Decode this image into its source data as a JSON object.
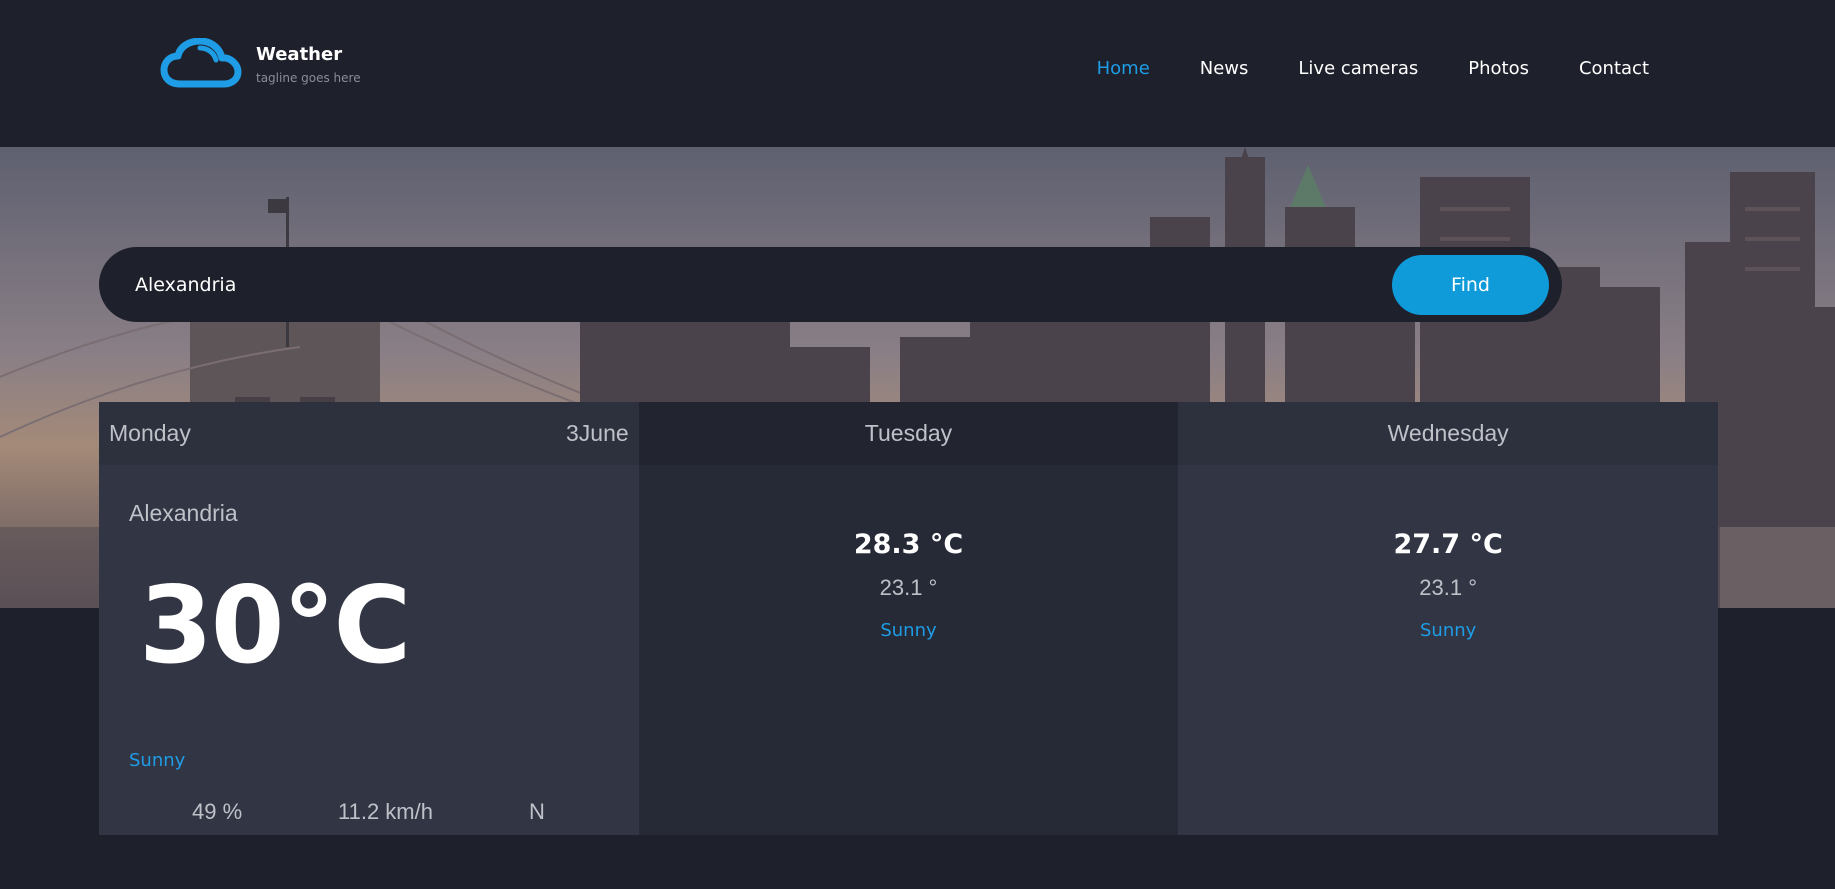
{
  "brand": {
    "title": "Weather",
    "tagline": "tagline goes here",
    "logo_icon": "cloud-icon",
    "accent_color": "#1e9de6"
  },
  "nav": {
    "items": [
      {
        "label": "Home",
        "active": true
      },
      {
        "label": "News",
        "active": false
      },
      {
        "label": "Live cameras",
        "active": false
      },
      {
        "label": "Photos",
        "active": false
      },
      {
        "label": "Contact",
        "active": false
      }
    ]
  },
  "search": {
    "value": "Alexandria",
    "button_label": "Find",
    "button_color": "#0f9ad9"
  },
  "forecast": {
    "today": {
      "day": "Monday",
      "date": "3June",
      "location": "Alexandria",
      "temperature": "30°C",
      "condition": "Sunny",
      "humidity": "49 %",
      "wind_speed": "11.2 km/h",
      "wind_direction": "N"
    },
    "days": [
      {
        "day": "Tuesday",
        "high": "28.3 °C",
        "low": "23.1 °",
        "condition": "Sunny"
      },
      {
        "day": "Wednesday",
        "high": "27.7 °C",
        "low": "23.1 °",
        "condition": "Sunny"
      }
    ]
  }
}
